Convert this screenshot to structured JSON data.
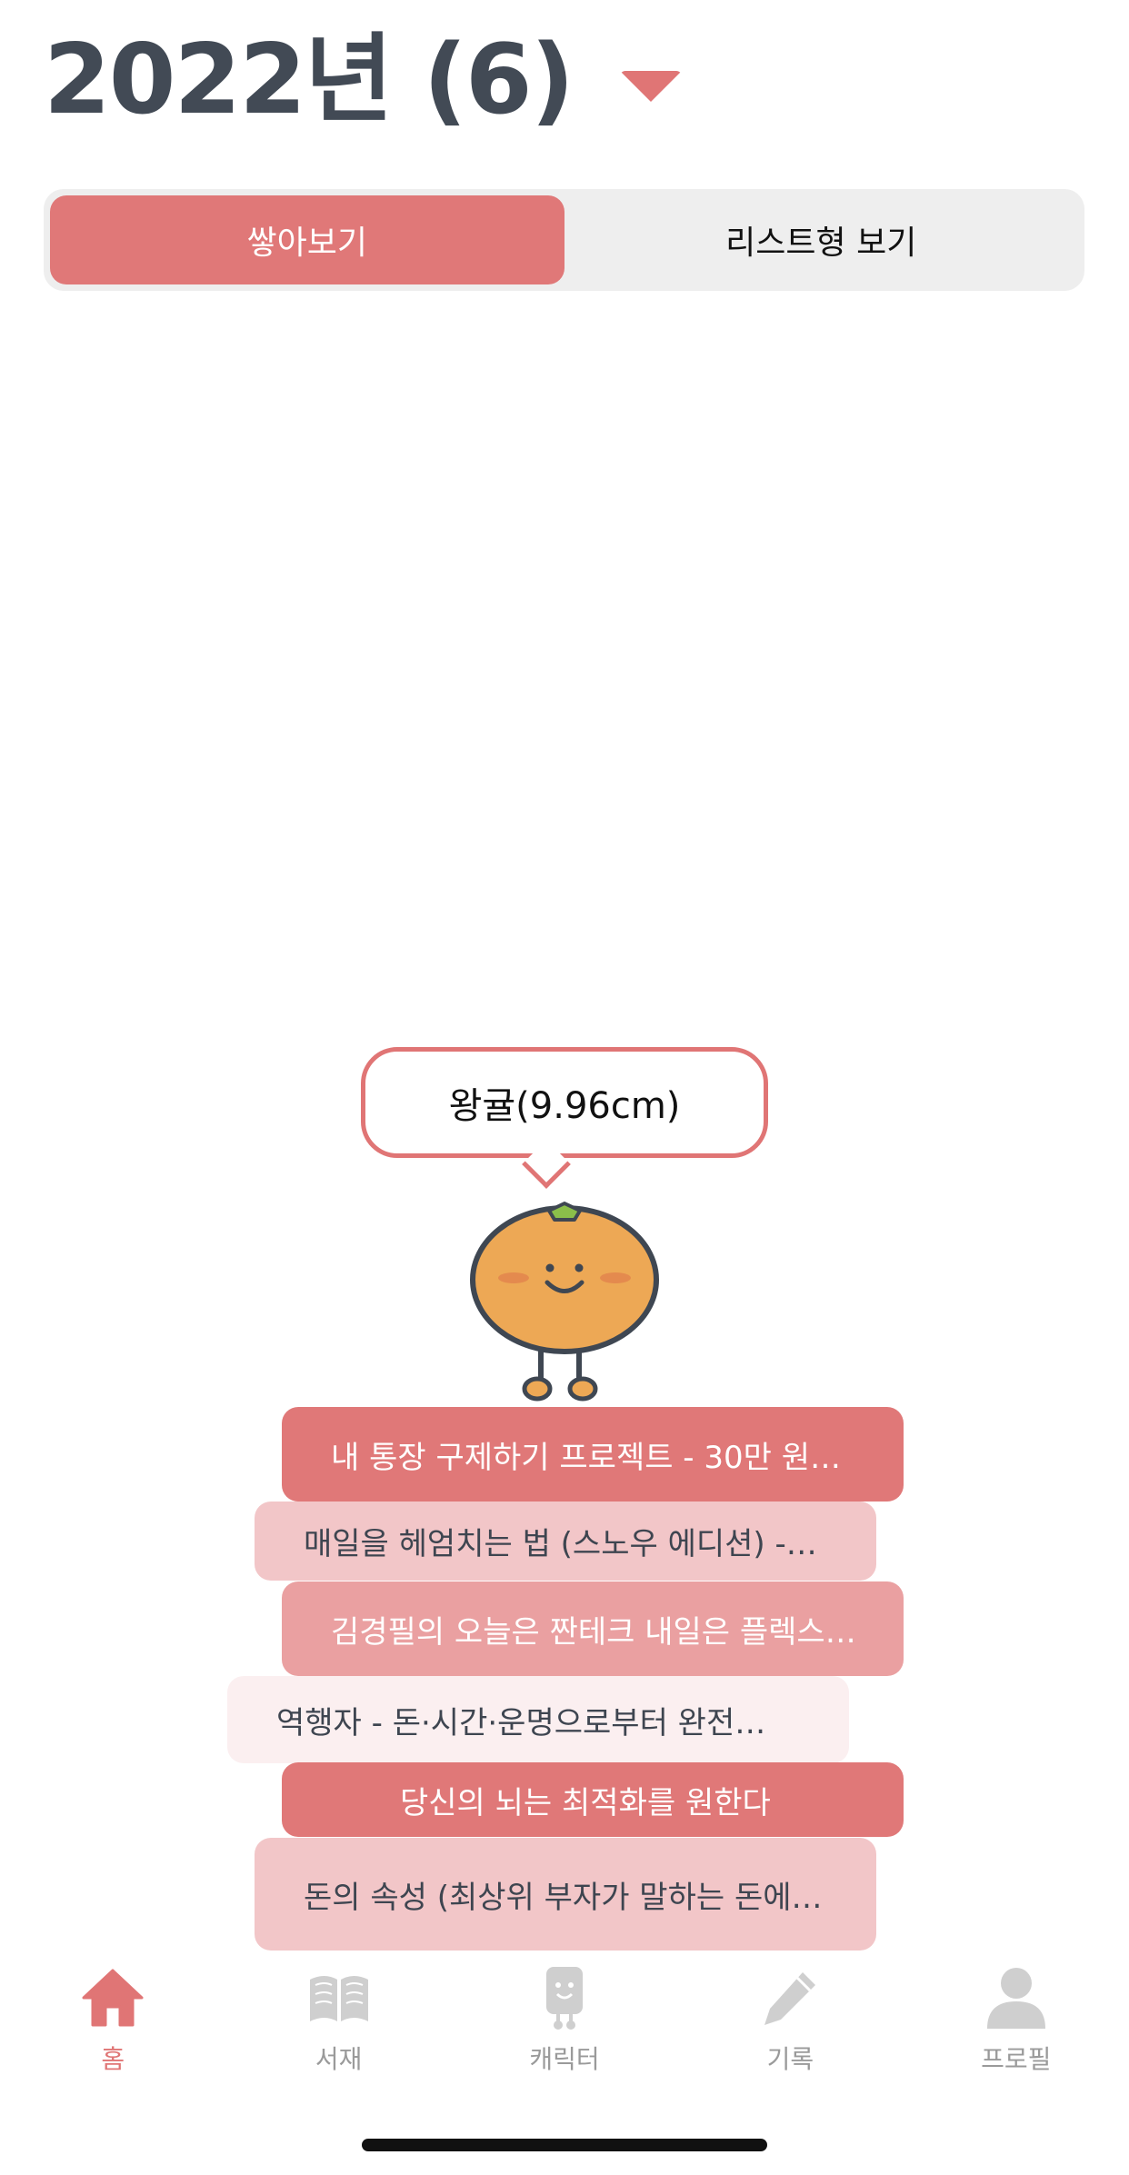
{
  "header": {
    "title": "2022년 (6)",
    "dropdown_icon": "caret-down-icon"
  },
  "view_toggle": {
    "options": [
      {
        "label": "쌓아보기",
        "active": true
      },
      {
        "label": "리스트형 보기",
        "active": false
      }
    ]
  },
  "character": {
    "speech": "왕귤(9.96cm)",
    "icon": "tangerine-character-icon"
  },
  "books": [
    {
      "title": "내 통장 구제하기 프로젝트 - 30만 원…"
    },
    {
      "title": "매일을 헤엄치는 법 (스노우 에디션) -…"
    },
    {
      "title": "김경필의 오늘은 짠테크 내일은 플렉스…"
    },
    {
      "title": "역행자 - 돈·시간·운명으로부터 완전…"
    },
    {
      "title": "당신의 뇌는 최적화를 원한다"
    },
    {
      "title": "돈의 속성 (최상위 부자가 말하는 돈에…"
    }
  ],
  "tab_bar": {
    "tabs": [
      {
        "label": "홈",
        "icon": "home-icon",
        "active": true
      },
      {
        "label": "서재",
        "icon": "book-icon",
        "active": false
      },
      {
        "label": "캐릭터",
        "icon": "character-icon",
        "active": false
      },
      {
        "label": "기록",
        "icon": "pencil-icon",
        "active": false
      },
      {
        "label": "프로필",
        "icon": "profile-icon",
        "active": false
      }
    ]
  },
  "colors": {
    "accent": "#e07575",
    "book_dark": "#e07878",
    "book_light": "#f2c6c8",
    "book_mid": "#eaa0a1",
    "book_pale": "#fbeff0",
    "text_dark": "#424a55",
    "tab_inactive": "#c8c8c8"
  }
}
